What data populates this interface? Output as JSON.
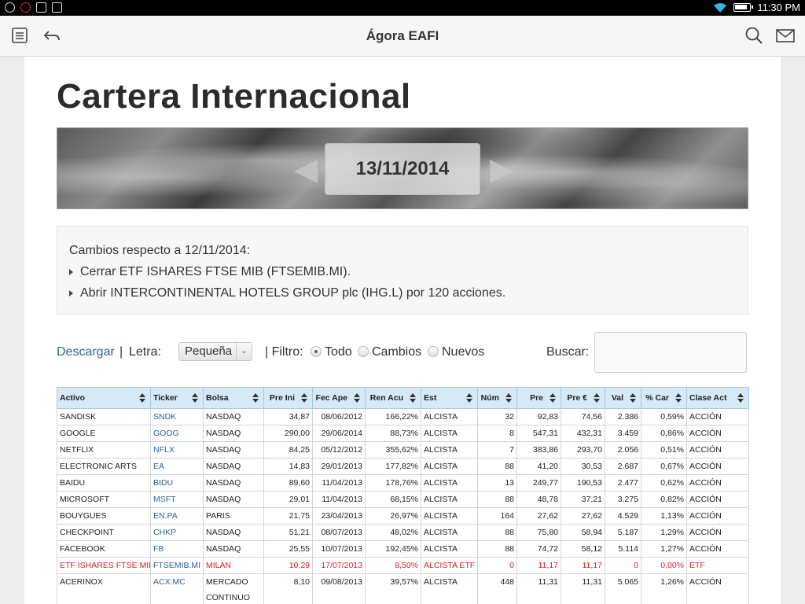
{
  "statusbar": {
    "time": "11:30 PM"
  },
  "app": {
    "title": "Ágora EAFI"
  },
  "page": {
    "title": "Cartera Internacional"
  },
  "banner": {
    "date": "13/11/2014"
  },
  "changes": {
    "heading": "Cambios respecto a 12/11/2014:",
    "items": [
      "Cerrar ETF ISHARES FTSE MIB (FTSEMIB.MI).",
      "Abrir INTERCONTINENTAL HOTELS GROUP plc (IHG.L) por 120 acciones."
    ]
  },
  "controls": {
    "download": "Descargar",
    "sep1": "|",
    "letra_label": "Letra:",
    "letra_value": "Pequeña",
    "filtro_label": "| Filtro:",
    "radio_todo": "Todo",
    "radio_cambios": "Cambios",
    "radio_nuevos": "Nuevos",
    "search_label": "Buscar:"
  },
  "table": {
    "headers": [
      "Activo",
      "Ticker",
      "Bolsa",
      "Pre Ini",
      "Fec Ape",
      "Ren Acu",
      "Est",
      "Núm",
      "Pre",
      "Pre €",
      "Val",
      "% Car",
      "Clase Act"
    ],
    "rows": [
      [
        "SANDISK",
        "SNDK",
        "NASDAQ",
        "34,87",
        "08/06/2012",
        "166,22%",
        "ALCISTA",
        "32",
        "92,83",
        "74,56",
        "2.386",
        "0,59%",
        "ACCIÓN"
      ],
      [
        "GOOGLE",
        "GOOG",
        "NASDAQ",
        "290,00",
        "29/06/2014",
        "88,73%",
        "ALCISTA",
        "8",
        "547,31",
        "432,31",
        "3.459",
        "0,86%",
        "ACCIÓN"
      ],
      [
        "NETFLIX",
        "NFLX",
        "NASDAQ",
        "84,25",
        "05/12/2012",
        "355,62%",
        "ALCISTA",
        "7",
        "383,86",
        "293,70",
        "2.056",
        "0,51%",
        "ACCIÓN"
      ],
      [
        "ELECTRONIC ARTS",
        "EA",
        "NASDAQ",
        "14,83",
        "29/01/2013",
        "177,82%",
        "ALCISTA",
        "88",
        "41,20",
        "30,53",
        "2.687",
        "0,67%",
        "ACCIÓN"
      ],
      [
        "BAIDU",
        "BIDU",
        "NASDAQ",
        "89,60",
        "11/04/2013",
        "178,76%",
        "ALCISTA",
        "13",
        "249,77",
        "190,53",
        "2.477",
        "0,62%",
        "ACCIÓN"
      ],
      [
        "MICROSOFT",
        "MSFT",
        "NASDAQ",
        "29,01",
        "11/04/2013",
        "68,15%",
        "ALCISTA",
        "88",
        "48,78",
        "37,21",
        "3.275",
        "0,82%",
        "ACCIÓN"
      ],
      [
        "BOUYGUES",
        "EN.PA",
        "PARIS",
        "21,75",
        "23/04/2013",
        "26,97%",
        "ALCISTA",
        "164",
        "27,62",
        "27,62",
        "4.529",
        "1,13%",
        "ACCIÓN"
      ],
      [
        "CHECKPOINT",
        "CHKP",
        "NASDAQ",
        "51,21",
        "08/07/2013",
        "48,02%",
        "ALCISTA",
        "88",
        "75,80",
        "58,94",
        "5.187",
        "1,29%",
        "ACCIÓN"
      ],
      [
        "FACEBOOK",
        "FB",
        "NASDAQ",
        "25,55",
        "10/07/2013",
        "192,45%",
        "ALCISTA",
        "88",
        "74,72",
        "58,12",
        "5.114",
        "1,27%",
        "ACCIÓN"
      ],
      [
        "ETF ISHARES FTSE MIB",
        "FTSEMIB.MI",
        "MILAN",
        "10,29",
        "17/07/2013",
        "8,50%",
        "ALCISTA ETF",
        "0",
        "11,17",
        "11,17",
        "0",
        "0,00%",
        "ETF"
      ],
      [
        "ACERINOX",
        "ACX.MC",
        "MERCADO CONTINUO",
        "8,10",
        "09/08/2013",
        "39,57%",
        "ALCISTA",
        "448",
        "11,31",
        "11,31",
        "5.065",
        "1,26%",
        "ACCIÓN"
      ]
    ],
    "highlight_color": "#e02020"
  }
}
